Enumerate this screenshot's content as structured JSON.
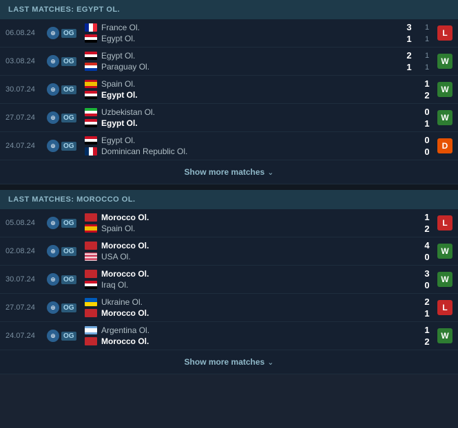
{
  "egypt_section": {
    "header": "LAST MATCHES: EGYPT OL.",
    "matches": [
      {
        "date": "06.08.24",
        "comp": "OG",
        "team1": {
          "name": "France Ol.",
          "flag": "france",
          "bold": false
        },
        "team2": {
          "name": "Egypt Ol.",
          "flag": "egypt2",
          "bold": false
        },
        "score1_main": "3",
        "score1_sub": "1",
        "score2_main": "1",
        "score2_sub": "1",
        "result": "L"
      },
      {
        "date": "03.08.24",
        "comp": "OG",
        "team1": {
          "name": "Egypt Ol.",
          "flag": "egypt2",
          "bold": false
        },
        "team2": {
          "name": "Paraguay Ol.",
          "flag": "paraguay",
          "bold": false
        },
        "score1_main": "2",
        "score1_sub": "1",
        "score2_main": "1",
        "score2_sub": "1",
        "result": "W"
      },
      {
        "date": "30.07.24",
        "comp": "OG",
        "team1": {
          "name": "Spain Ol.",
          "flag": "spain",
          "bold": false
        },
        "team2": {
          "name": "Egypt Ol.",
          "flag": "egypt2",
          "bold": true
        },
        "score1_main": "1",
        "score1_sub": "",
        "score2_main": "2",
        "score2_sub": "",
        "result": "W"
      },
      {
        "date": "27.07.24",
        "comp": "OG",
        "team1": {
          "name": "Uzbekistan Ol.",
          "flag": "uzbekistan",
          "bold": false
        },
        "team2": {
          "name": "Egypt Ol.",
          "flag": "egypt2",
          "bold": true
        },
        "score1_main": "0",
        "score1_sub": "",
        "score2_main": "1",
        "score2_sub": "",
        "result": "W"
      },
      {
        "date": "24.07.24",
        "comp": "OG",
        "team1": {
          "name": "Egypt Ol.",
          "flag": "egypt2",
          "bold": false
        },
        "team2": {
          "name": "Dominican Republic Ol.",
          "flag": "dominican",
          "bold": false
        },
        "score1_main": "0",
        "score1_sub": "",
        "score2_main": "0",
        "score2_sub": "",
        "result": "D"
      }
    ],
    "show_more": "Show more matches"
  },
  "morocco_section": {
    "header": "LAST MATCHES: MOROCCO OL.",
    "matches": [
      {
        "date": "05.08.24",
        "comp": "OG",
        "team1": {
          "name": "Morocco Ol.",
          "flag": "morocco2",
          "bold": true
        },
        "team2": {
          "name": "Spain Ol.",
          "flag": "spain",
          "bold": false
        },
        "score1_main": "1",
        "score1_sub": "",
        "score2_main": "2",
        "score2_sub": "",
        "result": "L"
      },
      {
        "date": "02.08.24",
        "comp": "OG",
        "team1": {
          "name": "Morocco Ol.",
          "flag": "morocco2",
          "bold": true
        },
        "team2": {
          "name": "USA Ol.",
          "flag": "usa",
          "bold": false
        },
        "score1_main": "4",
        "score1_sub": "",
        "score2_main": "0",
        "score2_sub": "",
        "result": "W"
      },
      {
        "date": "30.07.24",
        "comp": "OG",
        "team1": {
          "name": "Morocco Ol.",
          "flag": "morocco2",
          "bold": true
        },
        "team2": {
          "name": "Iraq Ol.",
          "flag": "iraq",
          "bold": false
        },
        "score1_main": "3",
        "score1_sub": "",
        "score2_main": "0",
        "score2_sub": "",
        "result": "W"
      },
      {
        "date": "27.07.24",
        "comp": "OG",
        "team1": {
          "name": "Ukraine Ol.",
          "flag": "ukraine",
          "bold": false
        },
        "team2": {
          "name": "Morocco Ol.",
          "flag": "morocco2",
          "bold": true
        },
        "score1_main": "2",
        "score1_sub": "",
        "score2_main": "1",
        "score2_sub": "",
        "result": "L"
      },
      {
        "date": "24.07.24",
        "comp": "OG",
        "team1": {
          "name": "Argentina Ol.",
          "flag": "argentina",
          "bold": false
        },
        "team2": {
          "name": "Morocco Ol.",
          "flag": "morocco2",
          "bold": true
        },
        "score1_main": "1",
        "score1_sub": "",
        "score2_main": "2",
        "score2_sub": "",
        "result": "W"
      }
    ],
    "show_more": "Show more matches"
  }
}
